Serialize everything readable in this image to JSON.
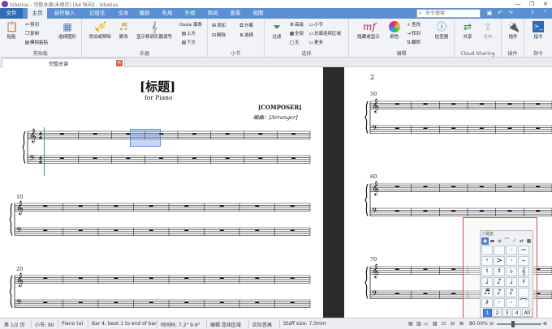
{
  "window": {
    "title": "Sibelius - 完整总谱(未保存) [A4 纵向] - Sibelius",
    "minimize": "—",
    "maximize": "❐",
    "close": "✕"
  },
  "tabs": [
    "文件",
    "主页",
    "音符输入",
    "记谱法",
    "文本",
    "播放",
    "布局",
    "外观",
    "审阅",
    "查看",
    "视图"
  ],
  "search": {
    "placeholder": "命令搜索"
  },
  "ribbon": {
    "clipboard": {
      "label": "剪贴板",
      "paste": "粘贴",
      "cut": "剪切",
      "copy": "复制",
      "paste_special": "模拟粘贴",
      "select_graphic": "选择图形"
    },
    "instruments": {
      "label": "乐器",
      "add_remove": "添加或移除",
      "change": "更改",
      "show_transp": "显示移调乐器调号",
      "ossia_up": "Ossia 谱表",
      "above": "上方",
      "below": "下方"
    },
    "bars": {
      "label": "小节",
      "add": "添加",
      "delete": "删除",
      "split": "分离",
      "join": "选择"
    },
    "select": {
      "label": "选择",
      "filter": "过滤",
      "advanced": "高级",
      "all": "全部",
      "none": "无",
      "bars": "小节",
      "system_passage": "总谱连续区域",
      "more": "更多"
    },
    "edit": {
      "label": "编辑",
      "hide_show": "隐藏或显示",
      "color": "颜色",
      "find": "查找",
      "goto": "转到",
      "flip": "翻转",
      "inspector": "检查器"
    },
    "cloud": {
      "label": "Cloud Sharing",
      "share": "共享",
      "publish": "发布"
    },
    "plugins": {
      "label": "插件",
      "plugin": "插件"
    },
    "cmds": {
      "label": "指令",
      "cmd": "指令"
    }
  },
  "document_tab": {
    "label": "完整总谱"
  },
  "score": {
    "title": "[标题]",
    "subtitle": "for Piano",
    "composer": "[COMPOSER]",
    "arranger": "编曲：[Arranger]",
    "page2_number": "2",
    "measure_numbers": {
      "p1_sys2": "10",
      "p1_sys3": "20",
      "p2_sys1": "50",
      "p2_sys2": "60",
      "p2_sys3": "70"
    }
  },
  "keypad": {
    "title": "小键盘",
    "layout_tabs": [
      "1",
      "2",
      "3",
      "4",
      "All"
    ],
    "active_layout": "1"
  },
  "status": {
    "page": "第 1/2 页",
    "bars": "小节: 90",
    "instrument": "Piano (a)",
    "selection": "Bar 4, beat 1 to end of bar",
    "timecode": "时间码: 7.2\"  9.6\"",
    "mode": "编辑 连续区域",
    "pitch": "实际音高",
    "staff_size": "Staff size: 7.0mm",
    "zoom": "80.00%"
  },
  "colors": {
    "tab_bar": "#5b8fcf",
    "file_tab": "#2f6cb5",
    "selection": "#5a8cdc",
    "keypad_frame": "#e04848"
  }
}
